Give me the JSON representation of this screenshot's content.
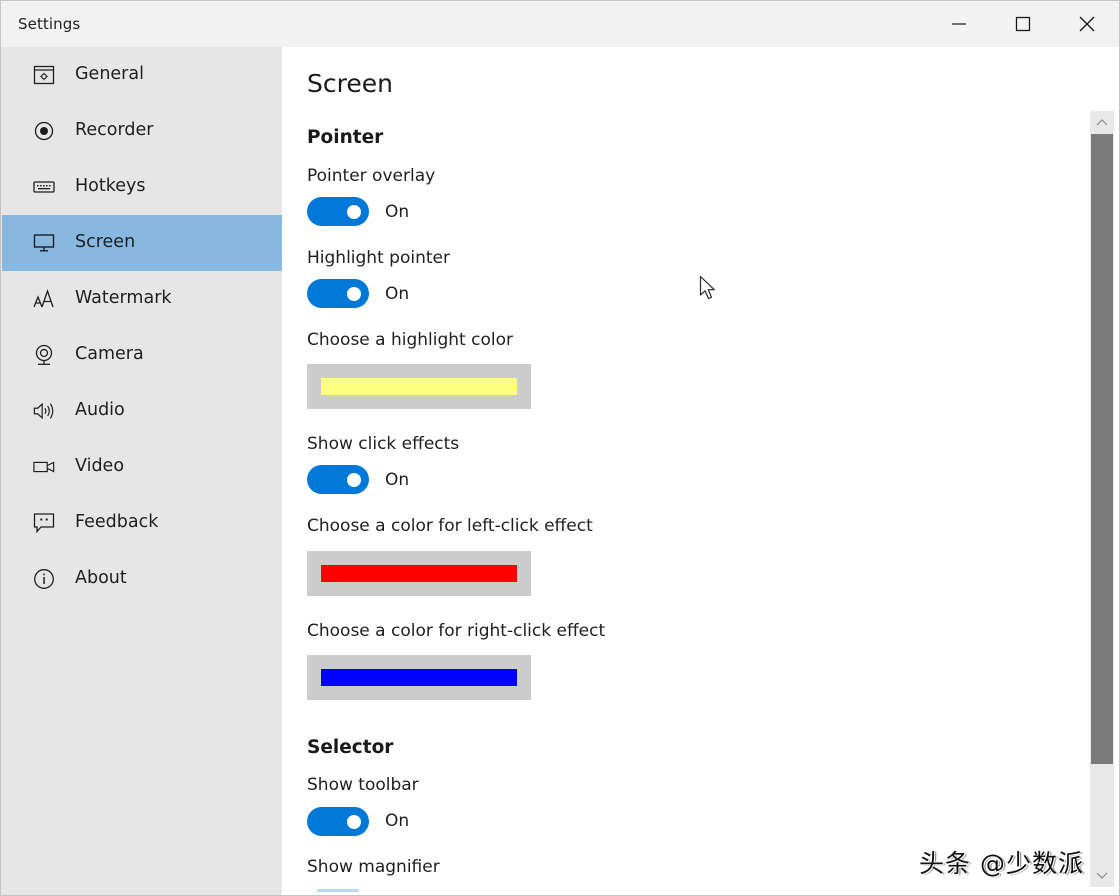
{
  "window": {
    "title": "Settings",
    "controls": {
      "minimize": "minimize-icon",
      "maximize": "maximize-icon",
      "close": "close-icon"
    }
  },
  "sidebar": {
    "selected": "Screen",
    "items": [
      {
        "label": "General",
        "icon": "general-settings-icon"
      },
      {
        "label": "Recorder",
        "icon": "record-icon"
      },
      {
        "label": "Hotkeys",
        "icon": "keyboard-icon"
      },
      {
        "label": "Screen",
        "icon": "monitor-icon"
      },
      {
        "label": "Watermark",
        "icon": "font-size-icon"
      },
      {
        "label": "Camera",
        "icon": "webcam-icon"
      },
      {
        "label": "Audio",
        "icon": "speaker-icon"
      },
      {
        "label": "Video",
        "icon": "video-camera-icon"
      },
      {
        "label": "Feedback",
        "icon": "feedback-icon"
      },
      {
        "label": "About",
        "icon": "info-icon"
      }
    ]
  },
  "main": {
    "title": "Screen",
    "sections": {
      "pointer": {
        "title": "Pointer",
        "pointer_overlay": {
          "label": "Pointer overlay",
          "state": "On",
          "on": true
        },
        "highlight_pointer": {
          "label": "Highlight pointer",
          "state": "On",
          "on": true
        },
        "highlight_color": {
          "label": "Choose a highlight color",
          "color": "#ffff80"
        },
        "show_click_effects": {
          "label": "Show click effects",
          "state": "On",
          "on": true
        },
        "left_click_color": {
          "label": "Choose a color for left-click effect",
          "color": "#ff0000"
        },
        "right_click_color": {
          "label": "Choose a color for right-click effect",
          "color": "#0000ff"
        }
      },
      "selector": {
        "title": "Selector",
        "show_toolbar": {
          "label": "Show toolbar",
          "state": "On",
          "on": true
        },
        "show_magnifier": {
          "label": "Show magnifier"
        }
      }
    }
  },
  "colors": {
    "accent": "#0078d7",
    "sidebar_bg": "#e6e6e6",
    "sidebar_selected": "#88b8e0",
    "titlebar_bg": "#f2f2f2",
    "swatch_frame": "#cccccc",
    "scroll_thumb": "#7a7a7a"
  },
  "overlay": {
    "watermark": "头条 @少数派"
  }
}
